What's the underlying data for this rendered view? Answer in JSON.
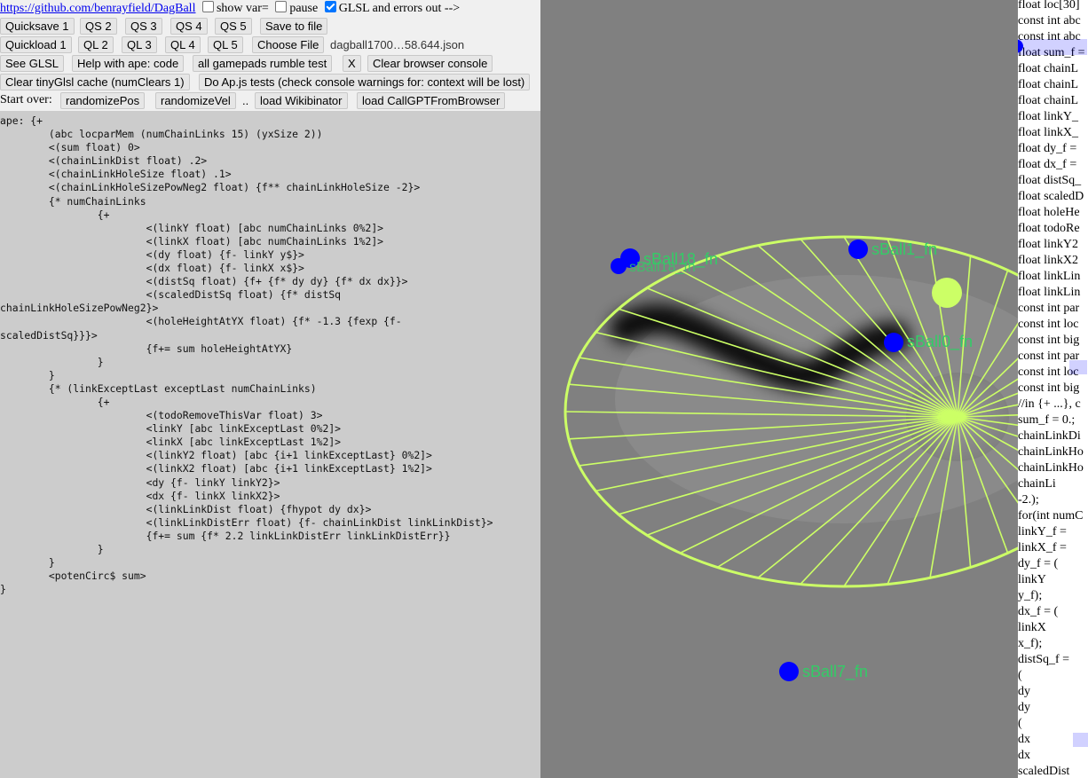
{
  "toolbar": {
    "repo_link": "https://github.com/benrayfield/DagBall",
    "show_var_label": "show var=",
    "pause_label": "pause",
    "glsl_label": "GLSL and errors out -->",
    "quicksave": "Quicksave 1",
    "qs2": "QS 2",
    "qs3": "QS 3",
    "qs4": "QS 4",
    "qs5": "QS 5",
    "save_to_file": "Save to file",
    "quickload": "Quickload 1",
    "ql2": "QL 2",
    "ql3": "QL 3",
    "ql4": "QL 4",
    "ql5": "QL 5",
    "choose_file": "Choose File",
    "file_name": "dagball1700…58.644.json",
    "see_glsl": "See GLSL",
    "help_ape": "Help with ape: code",
    "gamepads_rumble": "all gamepads rumble test",
    "x_button": "X",
    "clear_console": "Clear browser console",
    "clear_cache": "Clear tinyGlsl cache (numClears 1)",
    "do_apjs": "Do Ap.js tests (check console warnings for: context will be lost)",
    "start_over": "Start over:",
    "randomize_pos": "randomizePos",
    "randomize_vel": "randomizeVel",
    "dots": "..",
    "load_wikibinator": "load Wikibinator",
    "load_callgpt": "load CallGPTFromBrowser"
  },
  "editor": {
    "lines": [
      "ape: {+",
      "        (abc locparMem (numChainLinks 15) (yxSize 2))",
      "        <(sum float) 0>",
      "        <(chainLinkDist float) .2>",
      "        <(chainLinkHoleSize float) .1>",
      "        <(chainLinkHoleSizePowNeg2 float) {f** chainLinkHoleSize -2}>",
      "        {* numChainLinks",
      "                {+",
      "                        <(linkY float) [abc numChainLinks 0%2]>",
      "                        <(linkX float) [abc numChainLinks 1%2]>",
      "                        <(dy float) {f- linkY y$}>",
      "                        <(dx float) {f- linkX x$}>",
      "                        <(distSq float) {f+ {f* dy dy} {f* dx dx}}>",
      "                        <(scaledDistSq float) {f* distSq",
      "chainLinkHoleSizePowNeg2}>",
      "                        <(holeHeightAtYX float) {f* -1.3 {fexp {f-",
      "scaledDistSq}}}>",
      "                        {f+= sum holeHeightAtYX}",
      "                }",
      "        }",
      "        {* (linkExceptLast exceptLast numChainLinks)",
      "                {+",
      "                        <(todoRemoveThisVar float) 3>",
      "                        <linkY [abc linkExceptLast 0%2]>",
      "                        <linkX [abc linkExceptLast 1%2]>",
      "                        <(linkY2 float) [abc {i+1 linkExceptLast} 0%2]>",
      "                        <(linkX2 float) [abc {i+1 linkExceptLast} 1%2]>",
      "                        <dy {f- linkY linkY2}>",
      "                        <dx {f- linkX linkX2}>",
      "                        <(linkLinkDist float) {fhypot dy dx}>",
      "                        <(linkLinkDistErr float) {f- chainLinkDist linkLinkDist}>",
      "                        {f+= sum {f* 2.2 linkLinkDistErr linkLinkDistErr}}",
      "                }",
      "        }",
      "        <potenCirc$ sum>",
      "}"
    ]
  },
  "canvas": {
    "ball_labels": {
      "b18": "sBall18_fn",
      "b1": "sBall1_fn",
      "b0": "sBall0_fn",
      "b7": "sBall7_fn"
    },
    "colors": {
      "background": "#808080",
      "wheel": "#ccff66",
      "ball": "#0000ff",
      "label": "#33cc66"
    }
  },
  "glsl": {
    "lines": [
      "float loc[30]",
      "const int abc",
      "const int abc",
      "float sum_f =",
      "float chainL",
      "float chainL",
      "float chainL",
      "float linkY_",
      "float linkX_",
      "float dy_f =",
      "float dx_f =",
      "float distSq_",
      "float scaledD",
      "float holeHe",
      "float todoRe",
      "float linkY2",
      "float linkX2",
      "float linkLin",
      "float linkLin",
      "const int par",
      "const int loc",
      "const int big",
      "const int par",
      "const int loc",
      "const int big",
      "//in {+ ...}, c",
      "sum_f = 0.;",
      "chainLinkDi",
      "chainLinkHo",
      "chainLinkHo",
      "   chainLi",
      "   -2.);",
      "for(int numC",
      "   linkY_f =",
      "   linkX_f =",
      "   dy_f = (",
      "      linkY",
      "      y_f);",
      "   dx_f = (",
      "      linkX",
      "      x_f);",
      "   distSq_f =",
      "      (",
      "         dy",
      "         dy",
      "      (",
      "         dx",
      "         dx",
      "   scaledDist"
    ]
  }
}
